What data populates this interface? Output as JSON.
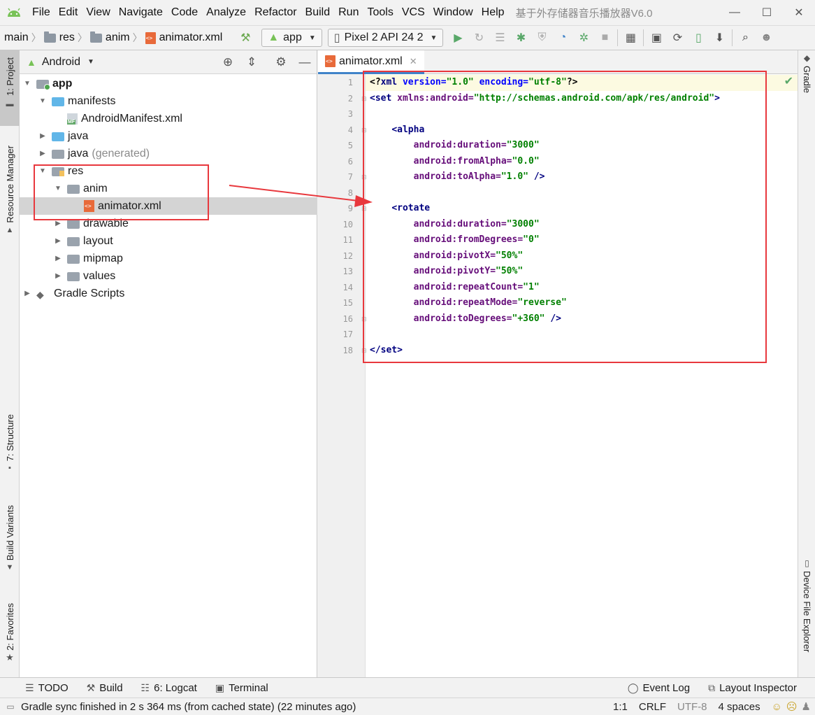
{
  "menubar": {
    "items": [
      "File",
      "Edit",
      "View",
      "Navigate",
      "Code",
      "Analyze",
      "Refactor",
      "Build",
      "Run",
      "Tools",
      "VCS",
      "Window",
      "Help"
    ],
    "title": "基于外存储器音乐播放器V6.0",
    "minimize": "—",
    "maximize": "☐",
    "close": "✕"
  },
  "toolbar": {
    "breadcrumb": [
      "main",
      "res",
      "anim",
      "animator.xml"
    ],
    "run_config": "app",
    "device": "Pixel 2 API 24 2"
  },
  "left_strip": {
    "project": "1: Project",
    "resource_manager": "Resource Manager",
    "structure": "7: Structure",
    "build_variants": "Build Variants",
    "favorites": "2: Favorites"
  },
  "project": {
    "view_name": "Android",
    "tree": [
      {
        "label": "app",
        "caret": "▼"
      },
      {
        "label": "manifests",
        "caret": "▼"
      },
      {
        "label": "AndroidManifest.xml",
        "caret": ""
      },
      {
        "label": "java",
        "caret": "▶"
      },
      {
        "label": "java",
        "suffix": "(generated)",
        "caret": "▶"
      },
      {
        "label": "res",
        "caret": "▼"
      },
      {
        "label": "anim",
        "caret": "▼"
      },
      {
        "label": "animator.xml",
        "caret": ""
      },
      {
        "label": "drawable",
        "caret": "▶"
      },
      {
        "label": "layout",
        "caret": "▶"
      },
      {
        "label": "mipmap",
        "caret": "▶"
      },
      {
        "label": "values",
        "caret": "▶"
      },
      {
        "label": "Gradle Scripts",
        "caret": "▶"
      }
    ]
  },
  "editor": {
    "tab": "animator.xml",
    "lines": [
      [
        [
          "t-plain",
          "<?"
        ],
        [
          "t-tag",
          "xml "
        ],
        [
          "t-attr",
          "version="
        ],
        [
          "t-val",
          "\"1.0\" "
        ],
        [
          "t-attr",
          "encoding="
        ],
        [
          "t-val",
          "\"utf-8\""
        ],
        [
          "t-plain",
          "?>"
        ]
      ],
      [
        [
          "t-tag",
          "<set "
        ],
        [
          "t-ns",
          "xmlns:android="
        ],
        [
          "t-val",
          "\"http://schemas.android.com/apk/res/android\""
        ],
        [
          "t-tag",
          ">"
        ]
      ],
      [],
      [
        [
          "t-plain",
          "    "
        ],
        [
          "t-tag",
          "<alpha"
        ]
      ],
      [
        [
          "t-plain",
          "        "
        ],
        [
          "t-ns",
          "android:duration="
        ],
        [
          "t-val",
          "\"3000\""
        ]
      ],
      [
        [
          "t-plain",
          "        "
        ],
        [
          "t-ns",
          "android:fromAlpha="
        ],
        [
          "t-val",
          "\"0.0\""
        ]
      ],
      [
        [
          "t-plain",
          "        "
        ],
        [
          "t-ns",
          "android:toAlpha="
        ],
        [
          "t-val",
          "\"1.0\" "
        ],
        [
          "t-tag",
          "/>"
        ]
      ],
      [],
      [
        [
          "t-plain",
          "    "
        ],
        [
          "t-tag",
          "<rotate"
        ]
      ],
      [
        [
          "t-plain",
          "        "
        ],
        [
          "t-ns",
          "android:duration="
        ],
        [
          "t-val",
          "\"3000\""
        ]
      ],
      [
        [
          "t-plain",
          "        "
        ],
        [
          "t-ns",
          "android:fromDegrees="
        ],
        [
          "t-val",
          "\"0\""
        ]
      ],
      [
        [
          "t-plain",
          "        "
        ],
        [
          "t-ns",
          "android:pivotX="
        ],
        [
          "t-val",
          "\"50%\""
        ]
      ],
      [
        [
          "t-plain",
          "        "
        ],
        [
          "t-ns",
          "android:pivotY="
        ],
        [
          "t-val",
          "\"50%\""
        ]
      ],
      [
        [
          "t-plain",
          "        "
        ],
        [
          "t-ns",
          "android:repeatCount="
        ],
        [
          "t-val",
          "\"1\""
        ]
      ],
      [
        [
          "t-plain",
          "        "
        ],
        [
          "t-ns",
          "android:repeatMode="
        ],
        [
          "t-val",
          "\"reverse\""
        ]
      ],
      [
        [
          "t-plain",
          "        "
        ],
        [
          "t-ns",
          "android:toDegrees="
        ],
        [
          "t-val",
          "\"+360\" "
        ],
        [
          "t-tag",
          "/>"
        ]
      ],
      [],
      [
        [
          "t-tag",
          "</set>"
        ]
      ]
    ]
  },
  "right_strip": {
    "gradle": "Gradle",
    "device_file_explorer": "Device File Explorer"
  },
  "bottom_tools": {
    "todo": "TODO",
    "build": "Build",
    "logcat": "6: Logcat",
    "terminal": "Terminal",
    "event_log": "Event Log",
    "layout_inspector": "Layout Inspector"
  },
  "status": {
    "message": "Gradle sync finished in 2 s 364 ms (from cached state) (22 minutes ago)",
    "position": "1:1",
    "line_sep": "CRLF",
    "encoding": "UTF-8",
    "indent": "4 spaces"
  },
  "colors": {
    "annotation": "#e8383d",
    "android_green": "#78c257",
    "selection": "#d4d4d4"
  }
}
